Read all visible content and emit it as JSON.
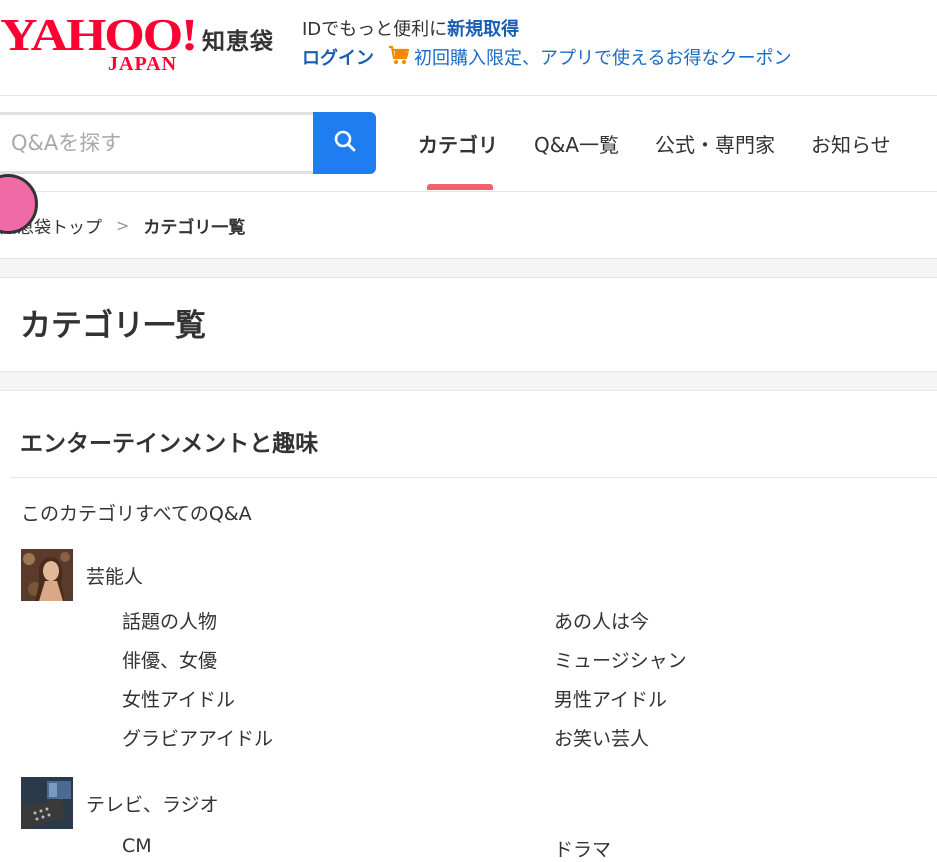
{
  "header": {
    "logo": {
      "line1": "YAHOO!",
      "line2": "JAPAN"
    },
    "service_name": "知恵袋",
    "promo_text": "IDでもっと便利に",
    "signup_link": "新規取得",
    "login_link": "ログイン",
    "coupon_link": "初回購入限定、アプリで使えるお得なクーポン",
    "icons": [
      "cart-icon"
    ]
  },
  "search": {
    "placeholder": "Q&Aを探す",
    "value": "",
    "button_icon": "search-icon"
  },
  "nav": {
    "tabs": [
      {
        "label": "カテゴリ",
        "active": true
      },
      {
        "label": "Q&A一覧",
        "active": false
      },
      {
        "label": "公式・専門家",
        "active": false
      },
      {
        "label": "お知らせ",
        "active": false
      }
    ]
  },
  "breadcrumb": {
    "home": "知恵袋トップ",
    "separator": ">",
    "current": "カテゴリ一覧"
  },
  "page": {
    "title": "カテゴリ一覧"
  },
  "section": {
    "title": "エンターテインメントと趣味",
    "all_link": "このカテゴリすべてのQ&A",
    "categories": [
      {
        "name": "芸能人",
        "icon": "celebrity-thumbnail",
        "subs": [
          "話題の人物",
          "あの人は今",
          "俳優、女優",
          "ミュージシャン",
          "女性アイドル",
          "男性アイドル",
          "グラビアアイドル",
          "お笑い芸人"
        ]
      },
      {
        "name": "テレビ、ラジオ",
        "icon": "tv-remote-thumbnail",
        "subs": [
          "CM",
          "ドラマ"
        ]
      }
    ]
  },
  "colors": {
    "brand_red": "#ff0033",
    "link_blue": "#1a5eb4",
    "search_button": "#1e7df0",
    "active_tab_underline": "#f0606e",
    "badge_pink": "#f06aa6"
  }
}
